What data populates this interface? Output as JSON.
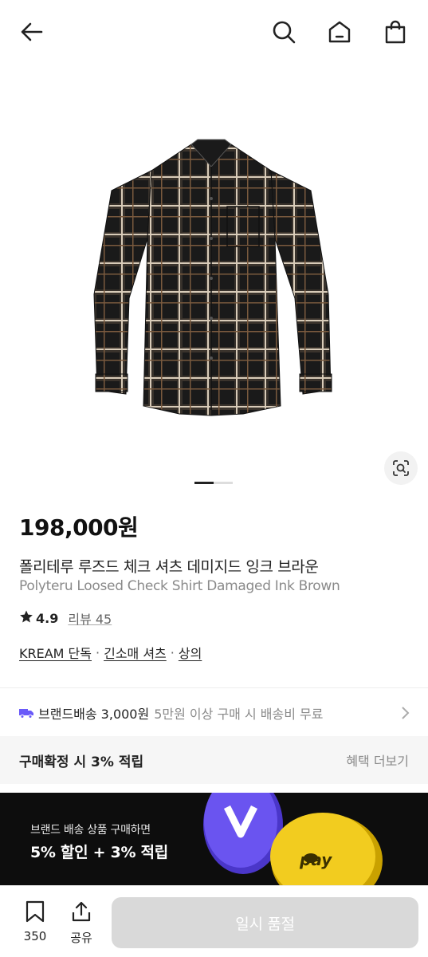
{
  "product": {
    "price": "198,000원",
    "name_ko": "폴리테루 루즈드 체크 셔츠 데미지드 잉크 브라운",
    "name_en": "Polyteru Loosed Check Shirt Damaged Ink Brown",
    "rating": "4.9",
    "reviews": "리뷰 45",
    "tags": [
      "KREAM 단독",
      "긴소매 셔츠",
      "상의"
    ],
    "tag_separator": "·"
  },
  "shipping": {
    "main": "브랜드배송 3,000원",
    "sub": "5만원 이상 구매 시 배송비 무료"
  },
  "points": {
    "label": "구매확정 시 3% 적립",
    "more": "혜택 더보기"
  },
  "banner": {
    "line1": "브랜드 배송 상품 구매하면",
    "line2": "5% 할인 + 3% 적립",
    "pay_label": "pay"
  },
  "bottom": {
    "bookmark_count": "350",
    "share_label": "공유",
    "cta_label": "일시 품절"
  },
  "icons": {
    "back": "back-arrow-icon",
    "search": "search-icon",
    "home": "home-icon",
    "bag": "shopping-bag-icon",
    "lens": "image-search-icon",
    "truck": "truck-icon",
    "chevron": "chevron-right-icon",
    "bookmark": "bookmark-icon",
    "share": "share-icon",
    "star": "star-icon"
  },
  "colors": {
    "truck": "#6a5af9",
    "cta_disabled": "#d9d9d9",
    "banner_bg": "#0d0d0d",
    "coin_purple": "#5b46e0",
    "coin_gold": "#f2cc1f"
  }
}
